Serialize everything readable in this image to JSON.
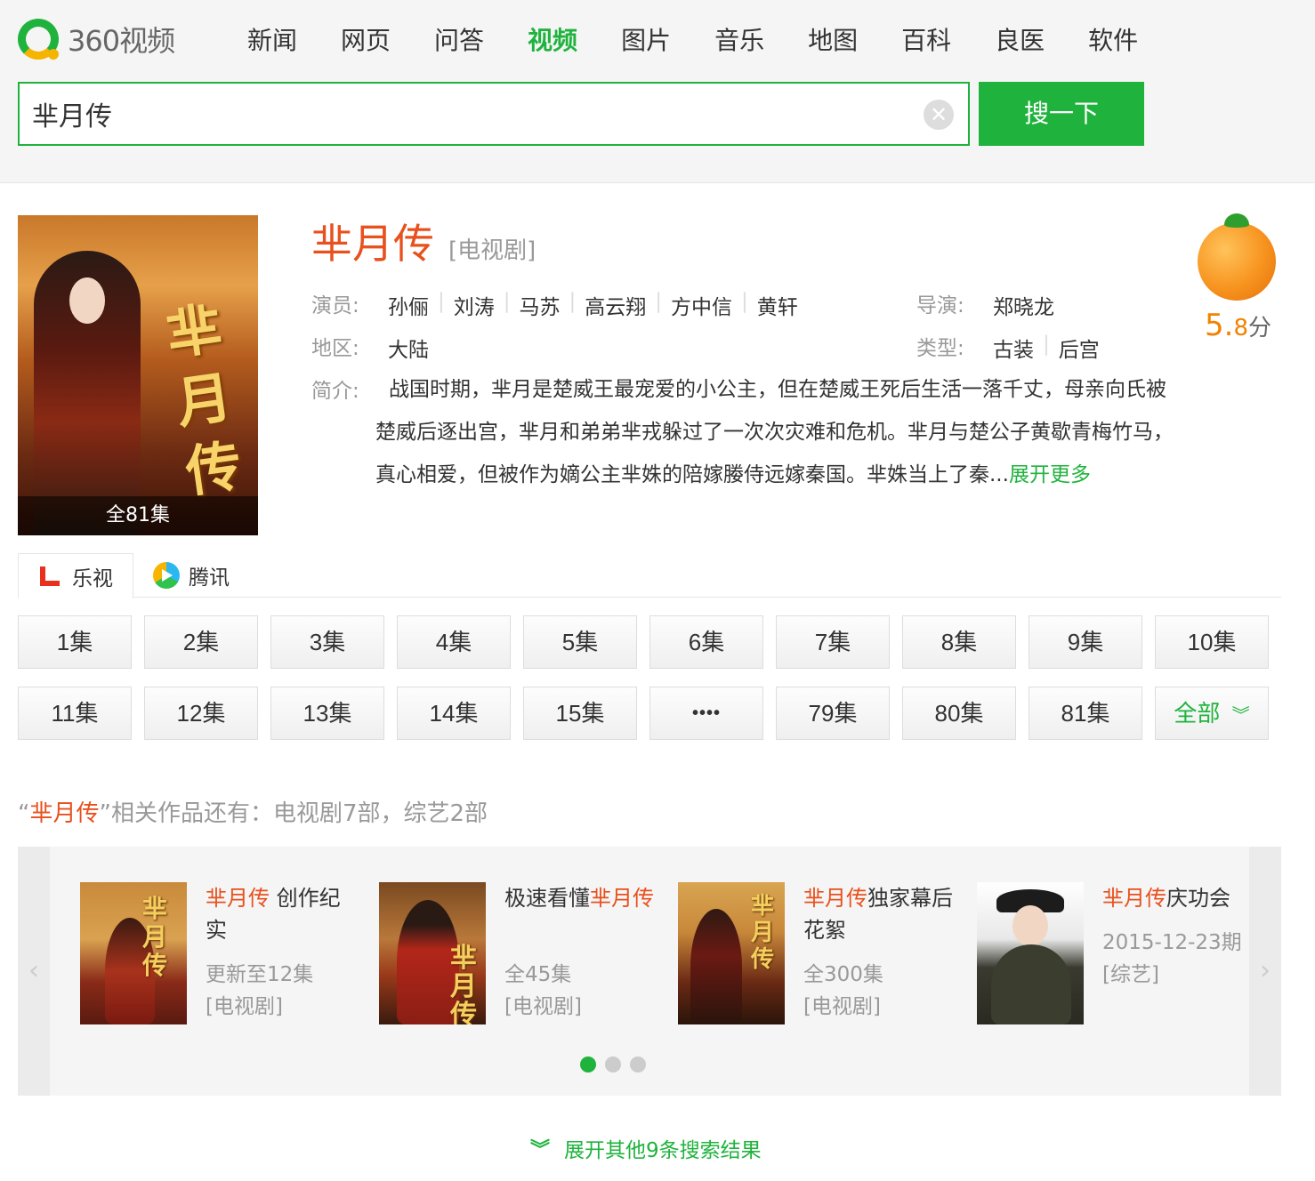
{
  "header": {
    "logo_text": "360视频",
    "nav": [
      "新闻",
      "网页",
      "问答",
      "视频",
      "图片",
      "音乐",
      "地图",
      "百科",
      "良医",
      "软件"
    ],
    "active_nav": "视频",
    "search_value": "芈月传",
    "search_button": "搜一下"
  },
  "show": {
    "title": "芈月传",
    "type": "[电视剧]",
    "poster_badge": "全81集",
    "poster_art": "芈月传",
    "actors_label": "演员:",
    "actors": [
      "孙俪",
      "刘涛",
      "马苏",
      "高云翔",
      "方中信",
      "黄轩"
    ],
    "director_label": "导演:",
    "director": "郑晓龙",
    "region_label": "地区:",
    "region": "大陆",
    "genre_label": "类型:",
    "genres": [
      "古装",
      "后宫"
    ],
    "desc_label": "简介:",
    "description": "战国时期，芈月是楚威王最宠爱的小公主，但在楚威王死后生活一落千丈，母亲向氏被楚威后逐出宫，芈月和弟弟芈戎躲过了一次次灾难和危机。芈月与楚公子黄歇青梅竹马，真心相爱，但被作为嫡公主芈姝的陪嫁媵侍远嫁秦国。芈姝当上了秦...",
    "more_label": "展开更多",
    "score_main": "5.",
    "score_decimal": "8",
    "score_unit": "分"
  },
  "sources": [
    "乐视",
    "腾讯"
  ],
  "episodes": {
    "row1": [
      "1集",
      "2集",
      "3集",
      "4集",
      "5集",
      "6集",
      "7集",
      "8集",
      "9集",
      "10集"
    ],
    "row2": [
      "11集",
      "12集",
      "13集",
      "14集",
      "15集",
      "••••",
      "79集",
      "80集",
      "81集"
    ],
    "all_label": "全部"
  },
  "related": {
    "quote_open": "“",
    "keyword": "芈月传",
    "rest": "”相关作品还有：电视剧7部，综艺2部",
    "items": [
      {
        "title_hl": "芈月传",
        "title_rest": " 创作纪实",
        "sub1": "更新至12集",
        "sub2": "[电视剧]"
      },
      {
        "title_pre": "极速看懂",
        "title_hl": "芈月传",
        "sub1": "全45集",
        "sub2": "[电视剧]"
      },
      {
        "title_hl": "芈月传",
        "title_rest": "独家幕后花絮",
        "sub1": "全300集",
        "sub2": "[电视剧]"
      },
      {
        "title_hl": "芈月传",
        "title_rest": "庆功会",
        "sub1": "2015-12-23期",
        "sub2": "[综艺]"
      }
    ]
  },
  "footer": {
    "expand_label": "展开其他9条搜索结果"
  }
}
